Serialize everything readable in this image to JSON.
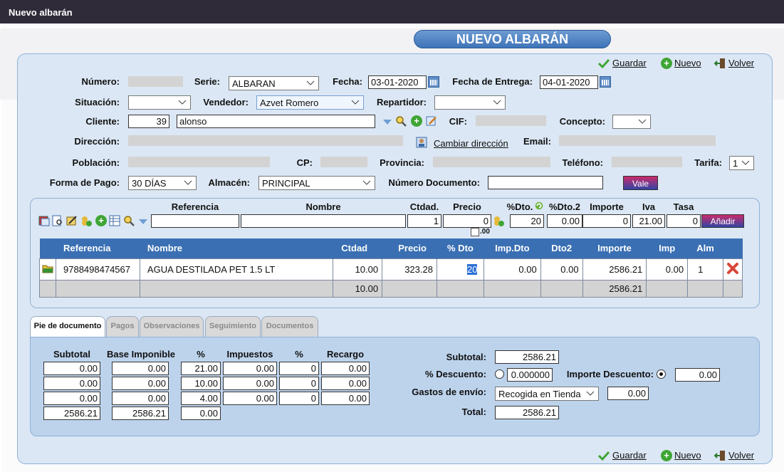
{
  "window_title": "Nuevo albarán",
  "page_title": "NUEVO ALBARÁN",
  "actions": {
    "save": "Guardar",
    "new": "Nuevo",
    "back": "Volver"
  },
  "form": {
    "numero_label": "Número:",
    "serie_label": "Serie:",
    "serie_value": "ALBARAN",
    "fecha_label": "Fecha:",
    "fecha_value": "03-01-2020",
    "entrega_label": "Fecha de Entrega:",
    "entrega_value": "04-01-2020",
    "situacion_label": "Situación:",
    "vendedor_label": "Vendedor:",
    "vendedor_value": "Azvet Romero",
    "repartidor_label": "Repartidor:",
    "cliente_label": "Cliente:",
    "cliente_code": "39",
    "cliente_name": "alonso",
    "cif_label": "CIF:",
    "concepto_label": "Concepto:",
    "direccion_label": "Dirección:",
    "cambiar_direccion": "Cambiar dirección",
    "email_label": "Email:",
    "poblacion_label": "Población:",
    "cp_label": "CP:",
    "provincia_label": "Provincia:",
    "telefono_label": "Teléfono:",
    "tarifa_label": "Tarifa:",
    "tarifa_value": "1",
    "forma_pago_label": "Forma de Pago:",
    "forma_pago_value": "30 DÍAS",
    "almacen_label": "Almacén:",
    "almacen_value": "PRINCIPAL",
    "num_doc_label": "Número Documento:",
    "vale_button": "Vale"
  },
  "line_entry": {
    "headers": {
      "referencia": "Referencia",
      "nombre": "Nombre",
      "ctdad": "Ctdad.",
      "precio": "Precio",
      "dto": "%Dto.",
      "dto2": "%Dto.2",
      "importe": "Importe",
      "iva": "Iva",
      "tasa": "Tasa"
    },
    "ctdad_value": "1",
    "precio_value": "0",
    "precio_decimals": ".00",
    "dto_value": "20",
    "dto2_value": "0.00",
    "importe_value": "0",
    "iva_value": "21.00",
    "tasa_value": "0",
    "add_button": "Añadir"
  },
  "grid": {
    "columns": [
      "Referencia",
      "Nombre",
      "Ctdad",
      "Precio",
      "% Dto",
      "Imp.Dto",
      "Dto2",
      "Importe",
      "Imp",
      "Alm"
    ],
    "rows": [
      {
        "referencia": "9788498474567",
        "nombre": "AGUA DESTILADA PET 1.5 LT",
        "ctdad": "10.00",
        "precio": "323.28",
        "dto": "20",
        "imp_dto": "0.00",
        "dto2": "0.00",
        "importe": "2586.21",
        "imp": "0.00",
        "alm": "1"
      }
    ],
    "totals": {
      "ctdad": "10.00",
      "importe": "2586.21"
    }
  },
  "tabs": [
    "Pie de documento",
    "Pagos",
    "Observaciones",
    "Seguimiento",
    "Documentos"
  ],
  "footer": {
    "headers": {
      "subtotal": "Subtotal",
      "base": "Base Imponible",
      "pct": "%",
      "impuestos": "Impuestos",
      "pct2": "%",
      "recargo": "Recargo"
    },
    "rows": [
      {
        "subtotal": "0.00",
        "base": "0.00",
        "pct": "21.00",
        "impuestos": "0.00",
        "pct2": "0",
        "recargo": "0.00"
      },
      {
        "subtotal": "0.00",
        "base": "0.00",
        "pct": "10.00",
        "impuestos": "0.00",
        "pct2": "0",
        "recargo": "0.00"
      },
      {
        "subtotal": "0.00",
        "base": "0.00",
        "pct": "4.00",
        "impuestos": "0.00",
        "pct2": "0",
        "recargo": "0.00"
      }
    ],
    "total_row": {
      "subtotal": "2586.21",
      "base": "2586.21",
      "pct": "0.00"
    },
    "summary": {
      "subtotal_label": "Subtotal:",
      "subtotal_value": "2586.21",
      "descuento_label": "% Descuento:",
      "descuento_value": "0.000000",
      "importe_desc_label": "Importe Descuento:",
      "importe_desc_value": "0.00",
      "gastos_label": "Gastos de envío:",
      "gastos_option": "Recogida en Tienda",
      "gastos_value": "0.00",
      "total_label": "Total:",
      "total_value": "2586.21"
    }
  }
}
